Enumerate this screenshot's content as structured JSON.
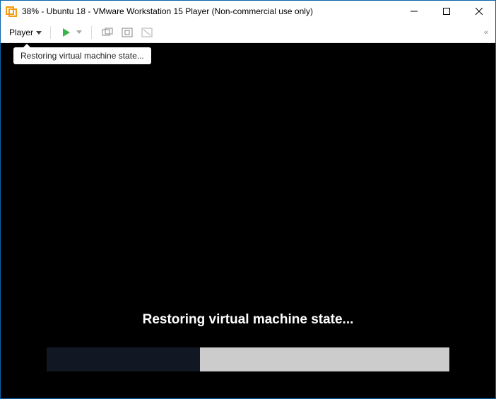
{
  "window": {
    "title": "38% - Ubuntu 18 - VMware Workstation 15 Player (Non-commercial use only)"
  },
  "toolbar": {
    "player_label": "Player"
  },
  "tooltip": {
    "text": "Restoring virtual machine state..."
  },
  "restore": {
    "heading": "Restoring virtual machine state...",
    "progress_percent": 38,
    "progress_width": "38%"
  }
}
